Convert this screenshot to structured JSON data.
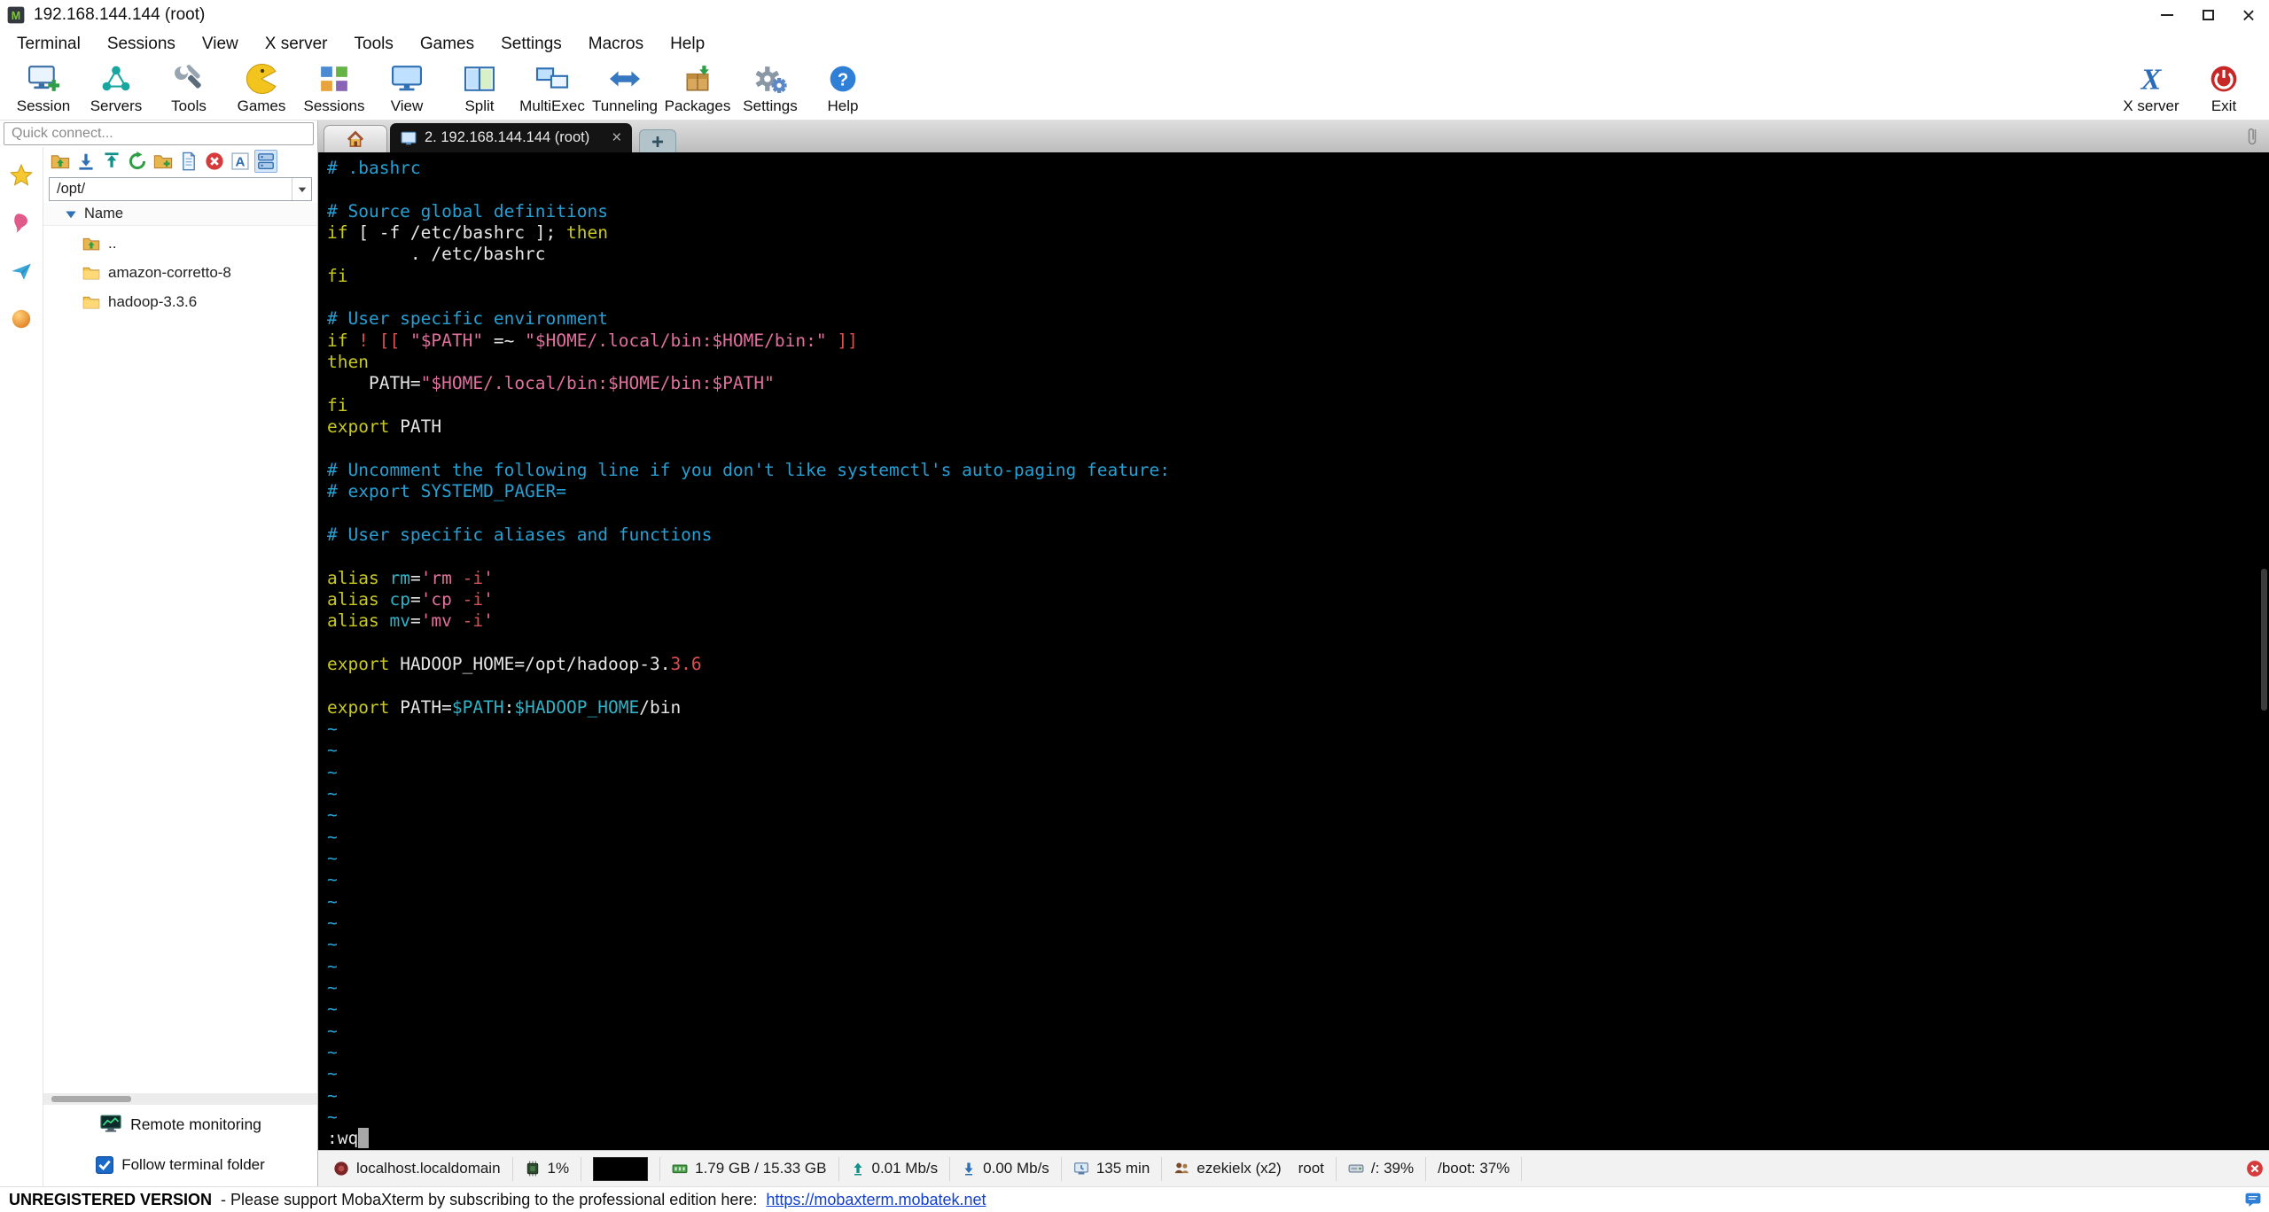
{
  "window": {
    "title": "192.168.144.144 (root)",
    "close_glyph": "×"
  },
  "menubar": [
    "Terminal",
    "Sessions",
    "View",
    "X server",
    "Tools",
    "Games",
    "Settings",
    "Macros",
    "Help"
  ],
  "toolbar": {
    "left": [
      {
        "label": "Session",
        "icon": "session-icon"
      },
      {
        "label": "Servers",
        "icon": "servers-icon"
      },
      {
        "label": "Tools",
        "icon": "tools-icon"
      },
      {
        "label": "Games",
        "icon": "games-icon"
      },
      {
        "label": "Sessions",
        "icon": "sessions-icon"
      },
      {
        "label": "View",
        "icon": "view-icon"
      },
      {
        "label": "Split",
        "icon": "split-icon"
      },
      {
        "label": "MultiExec",
        "icon": "multiexec-icon"
      },
      {
        "label": "Tunneling",
        "icon": "tunneling-icon"
      },
      {
        "label": "Packages",
        "icon": "packages-icon"
      },
      {
        "label": "Settings",
        "icon": "settings-icon"
      },
      {
        "label": "Help",
        "icon": "help-icon"
      }
    ],
    "right": [
      {
        "label": "X server",
        "icon": "xserver-icon"
      },
      {
        "label": "Exit",
        "icon": "exit-icon"
      }
    ]
  },
  "sidebar": {
    "quick_connect_placeholder": "Quick connect...",
    "panel_icons": [
      "panel-star-icon",
      "panel-tools-icon",
      "panel-macros-icon",
      "panel-games-icon"
    ],
    "file_toolbar_icons": [
      "folder-up-icon",
      "download-icon",
      "upload-icon",
      "refresh-icon",
      "new-folder-icon",
      "file-icon",
      "stop-icon",
      "encoding-icon",
      "server-icon"
    ],
    "path_value": "/opt/",
    "tree": {
      "header": "Name",
      "items": [
        {
          "label": "..",
          "icon": "folder-up-small-icon"
        },
        {
          "label": "amazon-corretto-8",
          "icon": "folder-icon"
        },
        {
          "label": "hadoop-3.3.6",
          "icon": "folder-icon"
        }
      ]
    },
    "remote_monitoring_label": "Remote monitoring",
    "follow_terminal_label": "Follow terminal folder"
  },
  "tabs": {
    "active_label": "2. 192.168.144.144 (root)",
    "close_glyph": "×"
  },
  "terminal": {
    "lines": [
      [
        [
          "comment",
          "# .bashrc"
        ]
      ],
      [],
      [
        [
          "comment",
          "# Source global definitions"
        ]
      ],
      [
        [
          "kw",
          "if"
        ],
        [
          "plain",
          " [ -f /etc/bashrc ]; "
        ],
        [
          "kw",
          "then"
        ]
      ],
      [
        [
          "plain",
          "        . /etc/bashrc"
        ]
      ],
      [
        [
          "kw",
          "fi"
        ]
      ],
      [],
      [
        [
          "comment",
          "# User specific environment"
        ]
      ],
      [
        [
          "kw",
          "if"
        ],
        [
          "plain",
          " "
        ],
        [
          "red",
          "! [["
        ],
        [
          "plain",
          " "
        ],
        [
          "str",
          "\"$PATH\""
        ],
        [
          "plain",
          " =~ "
        ],
        [
          "str",
          "\"$HOME/.local/bin:$HOME/bin:\""
        ],
        [
          "plain",
          " "
        ],
        [
          "red",
          "]]"
        ]
      ],
      [
        [
          "kw",
          "then"
        ]
      ],
      [
        [
          "plain",
          "    PATH="
        ],
        [
          "str",
          "\"$HOME/.local/bin:$HOME/bin:$PATH\""
        ]
      ],
      [
        [
          "kw",
          "fi"
        ]
      ],
      [
        [
          "kw",
          "export"
        ],
        [
          "plain",
          " PATH"
        ]
      ],
      [],
      [
        [
          "comment",
          "# Uncomment the following line if you don't like systemctl's auto-paging feature:"
        ]
      ],
      [
        [
          "comment",
          "# export SYSTEMD_PAGER="
        ]
      ],
      [],
      [
        [
          "comment",
          "# User specific aliases and functions"
        ]
      ],
      [],
      [
        [
          "kw",
          "alias"
        ],
        [
          "plain",
          " "
        ],
        [
          "cyan",
          "rm"
        ],
        [
          "plain",
          "="
        ],
        [
          "str",
          "'rm "
        ],
        [
          "red",
          "-i"
        ],
        [
          "str",
          "'"
        ]
      ],
      [
        [
          "kw",
          "alias"
        ],
        [
          "plain",
          " "
        ],
        [
          "cyan",
          "cp"
        ],
        [
          "plain",
          "="
        ],
        [
          "str",
          "'cp "
        ],
        [
          "red",
          "-i"
        ],
        [
          "str",
          "'"
        ]
      ],
      [
        [
          "kw",
          "alias"
        ],
        [
          "plain",
          " "
        ],
        [
          "cyan",
          "mv"
        ],
        [
          "plain",
          "="
        ],
        [
          "str",
          "'mv "
        ],
        [
          "red",
          "-i"
        ],
        [
          "str",
          "'"
        ]
      ],
      [],
      [
        [
          "kw",
          "export"
        ],
        [
          "plain",
          " HADOOP_HOME=/opt/hadoop-3."
        ],
        [
          "red",
          "3.6"
        ]
      ],
      [],
      [
        [
          "kw",
          "export"
        ],
        [
          "plain",
          " PATH="
        ],
        [
          "cyan",
          "$PATH"
        ],
        [
          "plain",
          ":"
        ],
        [
          "cyan",
          "$HADOOP_HOME"
        ],
        [
          "plain",
          "/bin"
        ]
      ],
      [
        [
          "tilde",
          "~"
        ]
      ],
      [
        [
          "tilde",
          "~"
        ]
      ],
      [
        [
          "tilde",
          "~"
        ]
      ],
      [
        [
          "tilde",
          "~"
        ]
      ],
      [
        [
          "tilde",
          "~"
        ]
      ],
      [
        [
          "tilde",
          "~"
        ]
      ],
      [
        [
          "tilde",
          "~"
        ]
      ],
      [
        [
          "tilde",
          "~"
        ]
      ],
      [
        [
          "tilde",
          "~"
        ]
      ],
      [
        [
          "tilde",
          "~"
        ]
      ],
      [
        [
          "tilde",
          "~"
        ]
      ],
      [
        [
          "tilde",
          "~"
        ]
      ],
      [
        [
          "tilde",
          "~"
        ]
      ],
      [
        [
          "tilde",
          "~"
        ]
      ],
      [
        [
          "tilde",
          "~"
        ]
      ],
      [
        [
          "tilde",
          "~"
        ]
      ],
      [
        [
          "tilde",
          "~"
        ]
      ],
      [
        [
          "tilde",
          "~"
        ]
      ],
      [
        [
          "tilde",
          "~"
        ]
      ],
      [
        [
          "plain",
          ":wq"
        ],
        [
          "cursor",
          " "
        ]
      ]
    ]
  },
  "statusbar": {
    "items": [
      {
        "icon": "host-icon",
        "text": "localhost.localdomain"
      },
      {
        "icon": "cpu-icon",
        "text": "1%"
      },
      {
        "icon": "graph-box",
        "text": ""
      },
      {
        "icon": "ram-icon",
        "text": "1.79 GB / 15.33 GB"
      },
      {
        "icon": "upload-arrow-icon",
        "text": "0.01 Mb/s"
      },
      {
        "icon": "download-arrow-icon",
        "text": "0.00 Mb/s"
      },
      {
        "icon": "uptime-icon",
        "text": "135 min"
      },
      {
        "icon": "users-icon",
        "text": "ezekielx (x2)    root"
      },
      {
        "icon": "disk-icon",
        "text": "/: 39%"
      },
      {
        "icon": "",
        "text": "/boot: 37%"
      }
    ]
  },
  "footer": {
    "bold_text": "UNREGISTERED VERSION",
    "message": "-  Please support MobaXterm by subscribing to the professional edition here:",
    "link": "https://mobaxterm.mobatek.net"
  },
  "colors": {
    "comment": "#26a0d4",
    "kw": "#c8c822",
    "str": "#e0709c",
    "red": "#d85050",
    "cyan": "#30b3c7",
    "plain": "#e6e6e6",
    "tilde": "#26a0d4",
    "cursor": "#a8a8a8",
    "accent_blue": "#2f6fb3",
    "link": "#1140cc"
  }
}
